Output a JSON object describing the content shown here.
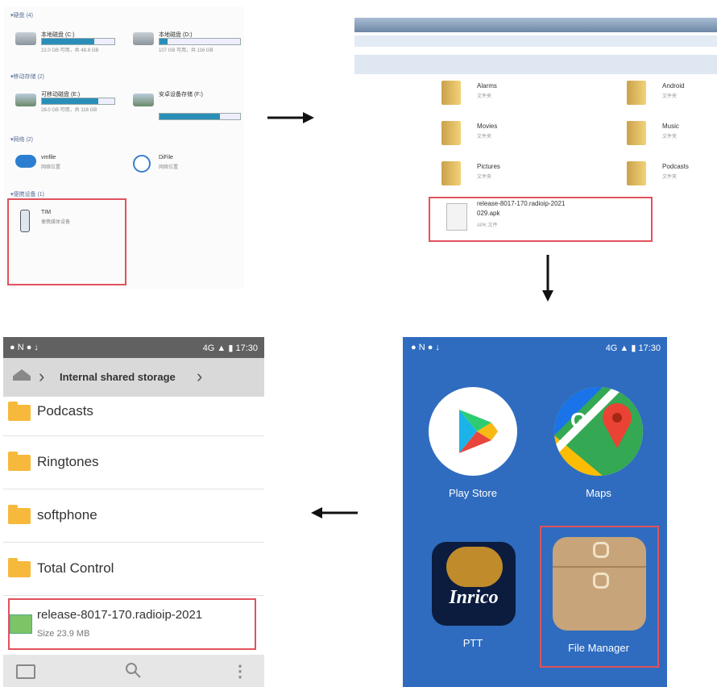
{
  "panel1": {
    "section_labels": [
      "▾硬盘 (4)",
      "▾移动存储 (2)",
      "▾网络 (2)",
      "▾便携设备 (1)"
    ],
    "drives": [
      {
        "name": "本地磁盘 (C:)",
        "sub": "22.0 GB 可用，共 48.8 GB",
        "fill": 0.72
      },
      {
        "name": "本地磁盘 (D:)",
        "sub": "107 GB 可用，共 116 GB",
        "fill": 0.1
      },
      {
        "name": "可移动磁盘 (E:)",
        "sub": "28.0 GB 可用，共 116 GB",
        "fill": 0.78
      },
      {
        "name": "安卓设备存储 (F:)",
        "sub": "",
        "fill": 0.75
      }
    ],
    "network": [
      {
        "name": "vmfile",
        "sub": "网络位置"
      },
      {
        "name": "DiFile",
        "sub": "网络位置"
      }
    ],
    "device": {
      "name": "TIM",
      "sub": "便携媒体设备"
    }
  },
  "panel2": {
    "folders": [
      {
        "name": "Alarms",
        "sub": "文件夹"
      },
      {
        "name": "Android",
        "sub": "文件夹"
      },
      {
        "name": "Movies",
        "sub": "文件夹"
      },
      {
        "name": "Music",
        "sub": "文件夹"
      },
      {
        "name": "Pictures",
        "sub": "文件夹"
      },
      {
        "name": "Podcasts",
        "sub": "文件夹"
      }
    ],
    "apk": {
      "name_line1": "release-8017-170.radioip-2021",
      "name_line2": "029.apk",
      "sub": "APK 文件"
    }
  },
  "panel3": {
    "status_left": "● N ● ↓",
    "status_right": "4G ▲ ▮ 17:30",
    "breadcrumb": "Internal shared storage",
    "rows": [
      "Podcasts",
      "Ringtones",
      "softphone",
      "Total Control"
    ],
    "apk_name": "release-8017-170.radioip-2021",
    "apk_size": "Size 23.9 MB"
  },
  "panel4": {
    "status_left": "● N ● ↓",
    "status_right": "4G ▲ ▮ 17:30",
    "apps": [
      {
        "label": "Play Store"
      },
      {
        "label": "Maps"
      },
      {
        "label": "PTT"
      },
      {
        "label": "File Manager"
      }
    ],
    "ptt_logo_text": "Inrico"
  }
}
